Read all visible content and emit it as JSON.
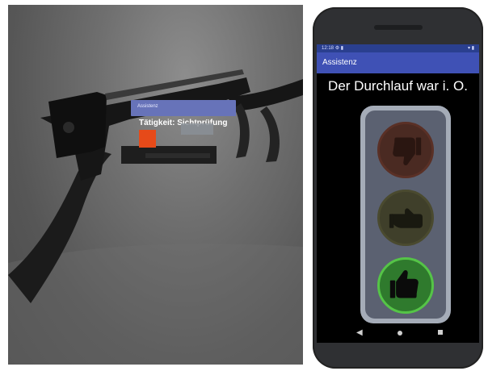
{
  "photo": {
    "hud": {
      "title": "Assistenz",
      "text": "Tätigkeit: Sichtprüfung",
      "accent": "#6773b9",
      "indicator_color": "#e64a19"
    }
  },
  "phone": {
    "statusbar": {
      "time": "12:18",
      "left_icons": "⚙ ▮",
      "right_icons": "▾ ▮"
    },
    "appbar": {
      "title": "Assistenz",
      "color": "#3f51b5"
    },
    "message": "Der Durchlauf war i. O.",
    "traffic_light": {
      "red_icon": "thumb-down-icon",
      "yellow_icon": "thumb-sideways-icon",
      "green_icon": "thumb-up-icon",
      "active": "green"
    },
    "navbar": {
      "back": "◀"
    }
  }
}
